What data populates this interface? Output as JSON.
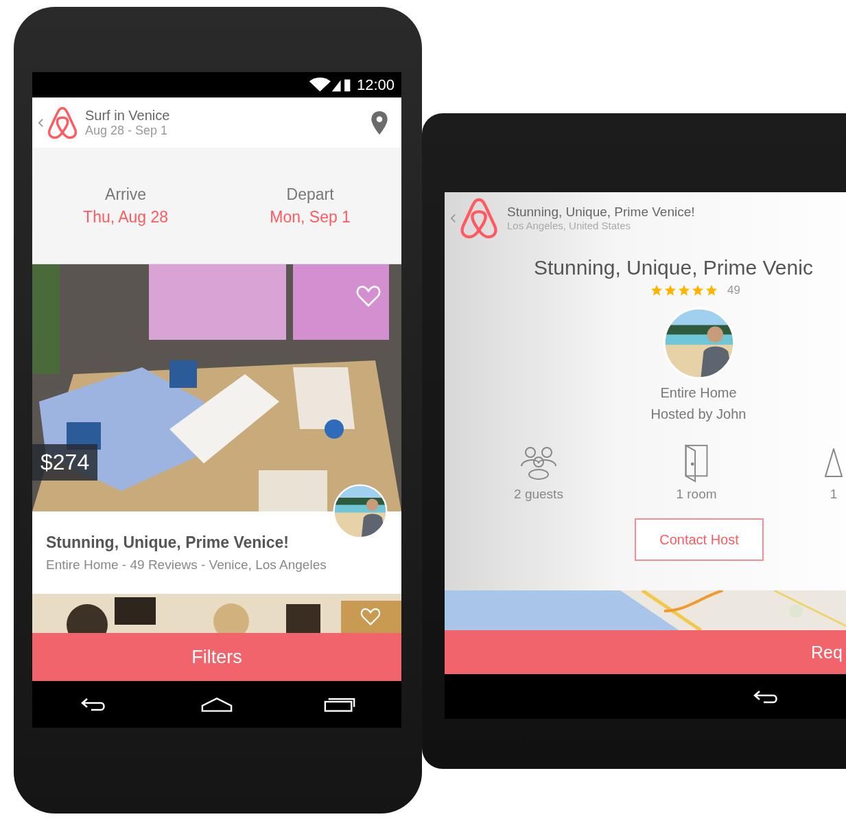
{
  "phone": {
    "status_bar": {
      "time": "12:00"
    },
    "app_bar": {
      "title": "Surf in Venice",
      "subtitle": "Aug 28 - Sep 1"
    },
    "dates": [
      {
        "label": "Arrive",
        "value": "Thu, Aug 28"
      },
      {
        "label": "Depart",
        "value": "Mon, Sep 1"
      }
    ],
    "listings": [
      {
        "price": "$274",
        "favorite": false,
        "title": "Stunning, Unique, Prime Venice!",
        "details": "Entire Home - 49 Reviews - Venice, Los Angeles"
      },
      {
        "favorite": false
      }
    ],
    "filters_button": "Filters"
  },
  "tablet": {
    "app_bar": {
      "title": "Stunning, Unique, Prime Venice!",
      "subtitle": "Los Angeles, United States"
    },
    "listing_title": "Stunning, Unique, Prime Venic",
    "stars": 5,
    "review_count": "49",
    "room_type": "Entire Home",
    "host": "Hosted by John",
    "amenities": [
      {
        "kind": "guests",
        "label": "2 guests"
      },
      {
        "kind": "room",
        "label": "1 room"
      },
      {
        "kind": "bath",
        "label": "1"
      }
    ],
    "contact_button": "Contact Host",
    "request_button": "Req"
  }
}
